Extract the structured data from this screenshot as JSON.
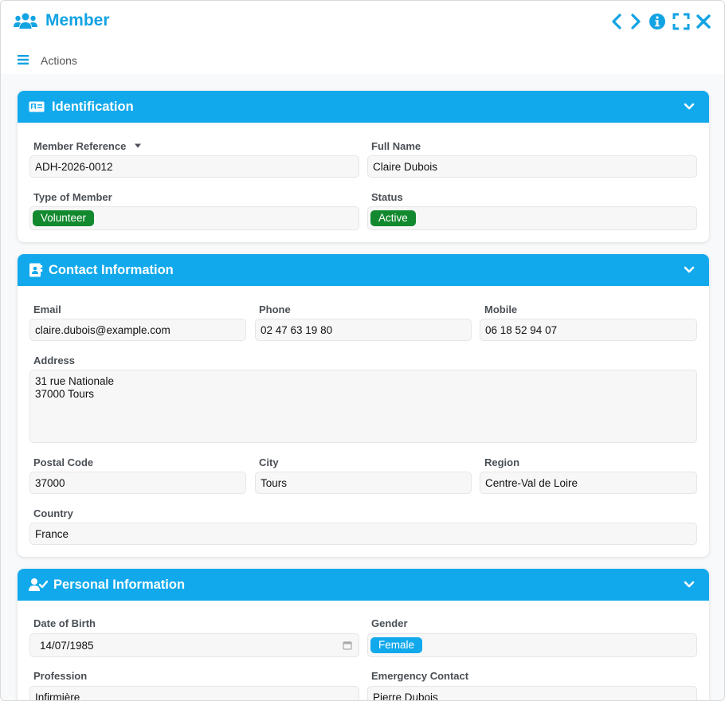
{
  "window": {
    "title": "Member",
    "actions_label": "Actions",
    "accent_color": "#12a3e3",
    "icons": [
      "users-icon",
      "prev-icon",
      "next-icon",
      "info-icon",
      "fullscreen-icon",
      "close-icon",
      "menu-icon"
    ]
  },
  "identification": {
    "title": "Identification",
    "icon": "id-card-icon",
    "member_reference_label": "Member Reference",
    "member_reference_value": "ADH-2026-0012",
    "full_name_label": "Full Name",
    "full_name_value": "Claire Dubois",
    "type_label": "Type of Member",
    "type_value": "Volunteer",
    "status_label": "Status",
    "status_value": "Active"
  },
  "contact": {
    "title": "Contact Information",
    "icon": "contact-book-icon",
    "email_label": "Email",
    "email_value": "claire.dubois@example.com",
    "phone_label": "Phone",
    "phone_value": "02 47 63 19 80",
    "mobile_label": "Mobile",
    "mobile_value": "06 18 52 94 07",
    "address_label": "Address",
    "address_value": "31 rue Nationale\n37000 Tours",
    "postal_code_label": "Postal Code",
    "postal_code_value": "37000",
    "city_label": "City",
    "city_value": "Tours",
    "region_label": "Region",
    "region_value": "Centre-Val de Loire",
    "country_label": "Country",
    "country_value": "France"
  },
  "personal": {
    "title": "Personal Information",
    "icon": "user-check-icon",
    "dob_label": "Date of Birth",
    "dob_value": "14/07/1985",
    "gender_label": "Gender",
    "gender_value": "Female",
    "profession_label": "Profession",
    "profession_value": "Infirmière",
    "emergency_label": "Emergency Contact",
    "emergency_value": "Pierre Dubois"
  },
  "colors": {
    "panel_header": "#12a9ec",
    "badge_green": "#13892f",
    "badge_blue": "#12a9ec"
  }
}
